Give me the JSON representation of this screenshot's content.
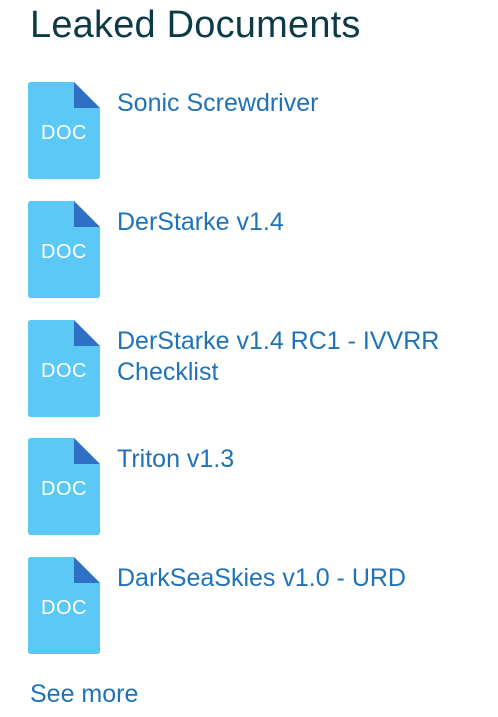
{
  "header": {
    "title": "Leaked Documents"
  },
  "documents": [
    {
      "label": "Sonic Screwdriver",
      "icon_text": "DOC",
      "icon": "doc-file-icon"
    },
    {
      "label": "DerStarke v1.4",
      "icon_text": "DOC",
      "icon": "doc-file-icon"
    },
    {
      "label": "DerStarke v1.4 RC1 - IVVRR Checklist",
      "icon_text": "DOC",
      "icon": "doc-file-icon"
    },
    {
      "label": "Triton v1.3",
      "icon_text": "DOC",
      "icon": "doc-file-icon"
    },
    {
      "label": "DarkSeaSkies v1.0 - URD",
      "icon_text": "DOC",
      "icon": "doc-file-icon"
    }
  ],
  "footer": {
    "see_more": "See more"
  },
  "colors": {
    "title": "#0d3b45",
    "link": "#1f72b8",
    "icon_body": "#5bc8f5",
    "icon_fold": "#2f6fc4"
  }
}
